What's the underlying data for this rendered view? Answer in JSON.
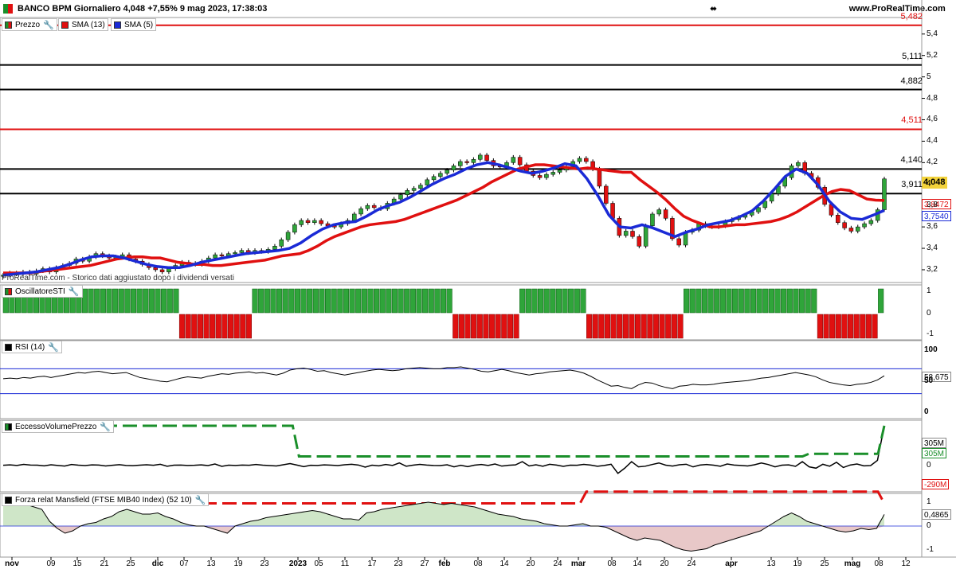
{
  "header": {
    "title": "BANCO BPM Giornaliero 4,048 +7,55% 9 mag 2023, 17:38:03",
    "site": "www.ProRealTime.com",
    "window_controls_icon": "window-arrows-icon"
  },
  "legend": [
    {
      "label": "Prezzo",
      "color": "#1a8f2a"
    },
    {
      "label": "SMA (13)",
      "color": "#e01010"
    },
    {
      "label": "SMA (5)",
      "color": "#1a2ad6"
    }
  ],
  "watermark": "ProRealTime.com - Storico dati aggiustato dopo i dividendi versati",
  "panels": {
    "sti": "OscillatoreSTI",
    "rsi": "RSI (14)",
    "vol": "EccessoVolumePrezzo",
    "mansfield": "Forza relat Mansfield (FTSE MIB40 Index) (52 10)"
  },
  "price_axis": [
    "5,4",
    "5,2",
    "5",
    "4,8",
    "4,6",
    "4,4",
    "4,2",
    "4",
    "3,8",
    "3,6",
    "3,4",
    "3,2"
  ],
  "price_levels": [
    {
      "label": "5,482",
      "value": 5.482,
      "color": "#e01010"
    },
    {
      "label": "5,111",
      "value": 5.111,
      "color": "#000000"
    },
    {
      "label": "4,882",
      "value": 4.882,
      "color": "#000000"
    },
    {
      "label": "4,511",
      "value": 4.511,
      "color": "#e01010"
    },
    {
      "label": "4,140",
      "value": 4.14,
      "color": "#000000"
    },
    {
      "label": "3,911",
      "value": 3.911,
      "color": "#000000"
    }
  ],
  "value_boxes": {
    "last": "4,048",
    "sma13": "3,8472",
    "sma5": "3,7540",
    "rsi": "58,675",
    "vol_a": "305M",
    "vol_b": "305M",
    "vol_neg": "-290M",
    "mansfield": "0,4865"
  },
  "sti_axis": [
    "1",
    "0",
    "-1"
  ],
  "rsi_axis": [
    "100",
    "50",
    "0"
  ],
  "vol_axis": [
    "0"
  ],
  "mansfield_axis": [
    "1",
    "0",
    "-1"
  ],
  "x_axis": [
    {
      "label": "nov",
      "bold": true
    },
    {
      "label": "09"
    },
    {
      "label": "15"
    },
    {
      "label": "21"
    },
    {
      "label": "25"
    },
    {
      "label": "dic",
      "bold": true
    },
    {
      "label": "07"
    },
    {
      "label": "13"
    },
    {
      "label": "19"
    },
    {
      "label": "23"
    },
    {
      "label": "2023",
      "bold": true
    },
    {
      "label": "05"
    },
    {
      "label": "11"
    },
    {
      "label": "17"
    },
    {
      "label": "23"
    },
    {
      "label": "27"
    },
    {
      "label": "feb",
      "bold": true
    },
    {
      "label": "08"
    },
    {
      "label": "14"
    },
    {
      "label": "20"
    },
    {
      "label": "24"
    },
    {
      "label": "mar",
      "bold": true
    },
    {
      "label": "08"
    },
    {
      "label": "14"
    },
    {
      "label": "20"
    },
    {
      "label": "24"
    },
    {
      "label": "apr",
      "bold": true
    },
    {
      "label": "13"
    },
    {
      "label": "19"
    },
    {
      "label": "25"
    },
    {
      "label": "mag",
      "bold": true
    },
    {
      "label": "08"
    },
    {
      "label": "12"
    }
  ],
  "chart_data": {
    "type": "line",
    "title": "BANCO BPM Giornaliero",
    "series": [
      {
        "name": "Prezzo",
        "values": [
          3.15,
          3.17,
          3.16,
          3.18,
          3.16,
          3.19,
          3.21,
          3.18,
          3.22,
          3.24,
          3.26,
          3.3,
          3.28,
          3.32,
          3.35,
          3.33,
          3.31,
          3.32,
          3.34,
          3.3,
          3.28,
          3.25,
          3.22,
          3.2,
          3.18,
          3.21,
          3.24,
          3.27,
          3.26,
          3.25,
          3.28,
          3.31,
          3.34,
          3.33,
          3.35,
          3.36,
          3.38,
          3.36,
          3.38,
          3.37,
          3.39,
          3.42,
          3.48,
          3.55,
          3.62,
          3.66,
          3.64,
          3.66,
          3.63,
          3.61,
          3.6,
          3.63,
          3.66,
          3.72,
          3.77,
          3.8,
          3.78,
          3.77,
          3.82,
          3.86,
          3.9,
          3.94,
          3.96,
          3.99,
          4.04,
          4.07,
          4.1,
          4.13,
          4.17,
          4.21,
          4.2,
          4.23,
          4.27,
          4.22,
          4.17,
          4.16,
          4.2,
          4.25,
          4.18,
          4.12,
          4.08,
          4.06,
          4.09,
          4.11,
          4.13,
          4.16,
          4.21,
          4.24,
          4.21,
          4.14,
          3.98,
          3.82,
          3.68,
          3.52,
          3.56,
          3.51,
          3.42,
          3.61,
          3.72,
          3.76,
          3.68,
          3.49,
          3.43,
          3.55,
          3.57,
          3.63,
          3.61,
          3.6,
          3.61,
          3.65,
          3.67,
          3.69,
          3.71,
          3.74,
          3.78,
          3.84,
          3.91,
          3.98,
          4.06,
          4.17,
          4.2,
          4.1,
          4.06,
          3.97,
          3.81,
          3.71,
          3.64,
          3.59,
          3.56,
          3.6,
          3.63,
          3.66,
          3.76,
          4.048
        ]
      },
      {
        "name": "SMA (13)",
        "values": [
          3.17,
          3.17,
          3.17,
          3.17,
          3.18,
          3.19,
          3.2,
          3.21,
          3.22,
          3.23,
          3.24,
          3.26,
          3.28,
          3.3,
          3.31,
          3.32,
          3.32,
          3.31,
          3.31,
          3.29,
          3.27,
          3.26,
          3.25,
          3.25,
          3.24,
          3.24,
          3.25,
          3.26,
          3.27,
          3.28,
          3.29,
          3.31,
          3.33,
          3.34,
          3.35,
          3.38,
          3.42,
          3.47,
          3.51,
          3.54,
          3.57,
          3.6,
          3.62,
          3.63,
          3.64,
          3.65,
          3.67,
          3.7,
          3.73,
          3.76,
          3.79,
          3.82,
          3.85,
          3.89,
          3.93,
          3.97,
          4.02,
          4.06,
          4.1,
          4.14,
          4.16,
          4.18,
          4.18,
          4.17,
          4.16,
          4.15,
          4.14,
          4.15,
          4.14,
          4.13,
          4.12,
          4.11,
          4.11,
          4.04,
          3.98,
          3.92,
          3.85,
          3.77,
          3.7,
          3.66,
          3.63,
          3.6,
          3.6,
          3.61,
          3.62,
          3.62,
          3.63,
          3.64,
          3.65,
          3.67,
          3.7,
          3.74,
          3.79,
          3.84,
          3.89,
          3.93,
          3.95,
          3.94,
          3.9,
          3.86,
          3.85,
          3.847
        ]
      },
      {
        "name": "SMA (5)",
        "values": [
          3.15,
          3.16,
          3.17,
          3.18,
          3.2,
          3.22,
          3.25,
          3.29,
          3.32,
          3.33,
          3.33,
          3.31,
          3.28,
          3.25,
          3.23,
          3.22,
          3.22,
          3.24,
          3.27,
          3.29,
          3.31,
          3.33,
          3.35,
          3.36,
          3.37,
          3.38,
          3.4,
          3.45,
          3.52,
          3.58,
          3.62,
          3.64,
          3.65,
          3.7,
          3.76,
          3.8,
          3.83,
          3.88,
          3.94,
          4.0,
          4.05,
          4.09,
          4.14,
          4.18,
          4.2,
          4.18,
          4.15,
          4.12,
          4.1,
          4.12,
          4.15,
          4.19,
          4.17,
          4.05,
          3.89,
          3.71,
          3.6,
          3.59,
          3.62,
          3.59,
          3.55,
          3.51,
          3.55,
          3.58,
          3.62,
          3.64,
          3.66,
          3.7,
          3.75,
          3.84,
          3.95,
          4.07,
          4.14,
          4.1,
          3.99,
          3.84,
          3.74,
          3.68,
          3.67,
          3.71,
          3.754
        ]
      }
    ],
    "sti_signal": [
      1,
      1,
      1,
      1,
      1,
      1,
      1,
      1,
      1,
      1,
      1,
      1,
      1,
      1,
      1,
      1,
      1,
      1,
      1,
      1,
      1,
      1,
      1,
      1,
      1,
      1,
      1,
      1,
      1,
      -1,
      -1,
      -1,
      -1,
      -1,
      -1,
      -1,
      -1,
      -1,
      -1,
      -1,
      -1,
      1,
      1,
      1,
      1,
      1,
      1,
      1,
      1,
      1,
      1,
      1,
      1,
      1,
      1,
      1,
      1,
      1,
      1,
      1,
      1,
      1,
      1,
      1,
      1,
      1,
      1,
      1,
      1,
      1,
      1,
      1,
      1,
      1,
      -1,
      -1,
      -1,
      -1,
      -1,
      -1,
      -1,
      -1,
      -1,
      -1,
      -1,
      1,
      1,
      1,
      1,
      1,
      1,
      1,
      1,
      1,
      1,
      1,
      -1,
      -1,
      -1,
      -1,
      -1,
      -1,
      -1,
      -1,
      -1,
      -1,
      -1,
      -1,
      -1,
      -1,
      -1,
      -1,
      1,
      1,
      1,
      1,
      1,
      1,
      1,
      1,
      1,
      1,
      1,
      1,
      1,
      1,
      1,
      1,
      1,
      1,
      1,
      1,
      1,
      1,
      -1,
      -1,
      -1,
      -1,
      -1,
      -1,
      -1,
      -1,
      -1,
      -1,
      1
    ],
    "rsi": [
      54,
      55,
      54,
      56,
      55,
      57,
      58,
      56,
      58,
      60,
      62,
      64,
      63,
      65,
      66,
      64,
      62,
      63,
      64,
      60,
      56,
      54,
      52,
      50,
      49,
      52,
      55,
      57,
      56,
      55,
      58,
      60,
      62,
      61,
      63,
      64,
      65,
      63,
      64,
      62,
      60,
      63,
      68,
      70,
      71,
      69,
      66,
      67,
      64,
      62,
      60,
      62,
      64,
      66,
      68,
      69,
      68,
      67,
      68,
      70,
      71,
      72,
      71,
      70,
      70,
      72,
      72,
      73,
      71,
      69,
      66,
      65,
      67,
      69,
      67,
      64,
      62,
      60,
      62,
      63,
      65,
      66,
      67,
      68,
      66,
      63,
      58,
      52,
      47,
      42,
      43,
      40,
      38,
      44,
      48,
      47,
      43,
      40,
      38,
      42,
      43,
      45,
      44,
      44,
      45,
      47,
      48,
      49,
      50,
      51,
      53,
      55,
      56,
      58,
      60,
      62,
      64,
      62,
      60,
      57,
      52,
      48,
      46,
      44,
      43,
      45,
      46,
      48,
      52,
      58.675
    ],
    "vol_excess": [
      2,
      5,
      1,
      9,
      4,
      3,
      -2,
      6,
      1,
      -4,
      8,
      3,
      0,
      5,
      4,
      -3,
      2,
      7,
      1,
      -1,
      3,
      6,
      2,
      10,
      -5,
      3,
      4,
      1,
      2,
      5,
      0,
      12,
      -6,
      3,
      1,
      4,
      2,
      8,
      3,
      0,
      -3,
      6,
      15,
      4,
      -8,
      2,
      1,
      5,
      3,
      0,
      6,
      10,
      4,
      -12,
      3,
      -2,
      8,
      1,
      20,
      -5,
      3,
      9,
      4,
      1,
      0,
      6,
      -10,
      2,
      -8,
      3,
      8,
      1,
      12,
      -4,
      2,
      5,
      30,
      -3,
      6,
      -5,
      10,
      4,
      -6,
      3,
      2,
      9,
      4,
      -5,
      1,
      10,
      -60,
      -20,
      30,
      -10,
      -5,
      8,
      20,
      3,
      -4,
      6,
      10,
      -10,
      4,
      8,
      3,
      -5,
      12,
      4,
      1,
      -3,
      6,
      20,
      8,
      -10,
      3,
      5,
      -6,
      30,
      -10,
      -20,
      10,
      -5,
      25,
      -15,
      4,
      12,
      -2,
      0,
      40,
      305
    ],
    "vol_upper": [
      305,
      305,
      305,
      305,
      305,
      305,
      305,
      305,
      305,
      305,
      305,
      305,
      305,
      305,
      305,
      305,
      305,
      305,
      305,
      305,
      305,
      305,
      305,
      305,
      305,
      305,
      305,
      305,
      305,
      305,
      305,
      305,
      305,
      305,
      305,
      305,
      305,
      305,
      305,
      305,
      305,
      305,
      305,
      305,
      305,
      305,
      305,
      70,
      70,
      70,
      70,
      70,
      70,
      70,
      70,
      70,
      70,
      70,
      70,
      70,
      70,
      70,
      70,
      70,
      70,
      70,
      70,
      70,
      70,
      70,
      70,
      70,
      70,
      70,
      70,
      70,
      70,
      70,
      70,
      70,
      70,
      70,
      70,
      70,
      70,
      70,
      70,
      70,
      70,
      70,
      70,
      70,
      70,
      70,
      70,
      70,
      70,
      70,
      70,
      70,
      70,
      70,
      70,
      70,
      70,
      70,
      70,
      70,
      70,
      70,
      70,
      70,
      70,
      70,
      70,
      70,
      70,
      70,
      70,
      70,
      70,
      70,
      70,
      70,
      70,
      70,
      70,
      70,
      90,
      90,
      90,
      90,
      90,
      90,
      90,
      90,
      90,
      90,
      90,
      90,
      305
    ],
    "vol_lower": [
      -290,
      -290,
      -290,
      -290,
      -290,
      -290,
      -290,
      -290,
      -290,
      -290,
      -290,
      -290,
      -290,
      -290,
      -290,
      -290,
      -290,
      -290,
      -290,
      -290,
      -290,
      -290,
      -290,
      -290,
      -290,
      -290,
      -290,
      -290,
      -290,
      -290,
      -290,
      -290,
      -290,
      -290,
      -290,
      -290,
      -290,
      -290,
      -290,
      -290,
      -290,
      -290,
      -290,
      -290,
      -290,
      -290,
      -290,
      -290,
      -290,
      -290,
      -290,
      -290,
      -290,
      -290,
      -290,
      -290,
      -290,
      -290,
      -290,
      -290,
      -290,
      -290,
      -290,
      -290,
      -290,
      -290,
      -290,
      -290,
      -290,
      -290,
      -290,
      -290,
      -290,
      -290,
      -290,
      -290,
      -290,
      -290,
      -290,
      -290,
      -290,
      -290,
      -290,
      -290,
      -290,
      -290,
      -290,
      -290,
      -290,
      -290,
      -290,
      -290,
      -200,
      -200,
      -200,
      -200,
      -200,
      -200,
      -200,
      -200,
      -200,
      -200,
      -200,
      -200,
      -200,
      -200,
      -200,
      -200,
      -200,
      -200,
      -200,
      -200,
      -200,
      -200,
      -200,
      -200,
      -200,
      -200,
      -200,
      -200,
      -200,
      -200,
      -200,
      -200,
      -200,
      -200,
      -200,
      -200,
      -200,
      -200,
      -200,
      -200,
      -200,
      -200,
      -200,
      -200,
      -200,
      -200,
      -200,
      -290
    ],
    "mansfield": [
      0.9,
      0.9,
      0.85,
      0.9,
      0.8,
      0.7,
      0.2,
      -0.1,
      -0.3,
      -0.2,
      0.0,
      0.1,
      0.15,
      0.3,
      0.4,
      0.6,
      0.7,
      0.6,
      0.5,
      0.5,
      0.55,
      0.4,
      0.3,
      0.15,
      0.05,
      0.0,
      0.0,
      -0.1,
      -0.2,
      -0.3,
      0.0,
      0.1,
      0.2,
      0.25,
      0.35,
      0.4,
      0.45,
      0.5,
      0.55,
      0.6,
      0.65,
      0.6,
      0.5,
      0.4,
      0.3,
      0.3,
      0.25,
      0.55,
      0.6,
      0.7,
      0.75,
      0.8,
      0.85,
      0.9,
      0.95,
      1.0,
      0.95,
      0.9,
      0.95,
      0.9,
      0.85,
      0.8,
      0.7,
      0.6,
      0.5,
      0.45,
      0.4,
      0.3,
      0.25,
      0.2,
      0.1,
      0.05,
      0.0,
      0.0,
      0.05,
      0.1,
      0.0,
      0.0,
      -0.05,
      -0.2,
      -0.35,
      -0.5,
      -0.6,
      -0.5,
      -0.55,
      -0.6,
      -0.75,
      -0.9,
      -1.0,
      -1.05,
      -1.0,
      -0.95,
      -0.8,
      -0.7,
      -0.6,
      -0.5,
      -0.4,
      -0.3,
      -0.2,
      0.0,
      0.2,
      0.4,
      0.55,
      0.4,
      0.2,
      0.1,
      0.0,
      -0.1,
      -0.2,
      -0.25,
      -0.2,
      -0.1,
      -0.15,
      -0.1,
      0.4865
    ]
  }
}
